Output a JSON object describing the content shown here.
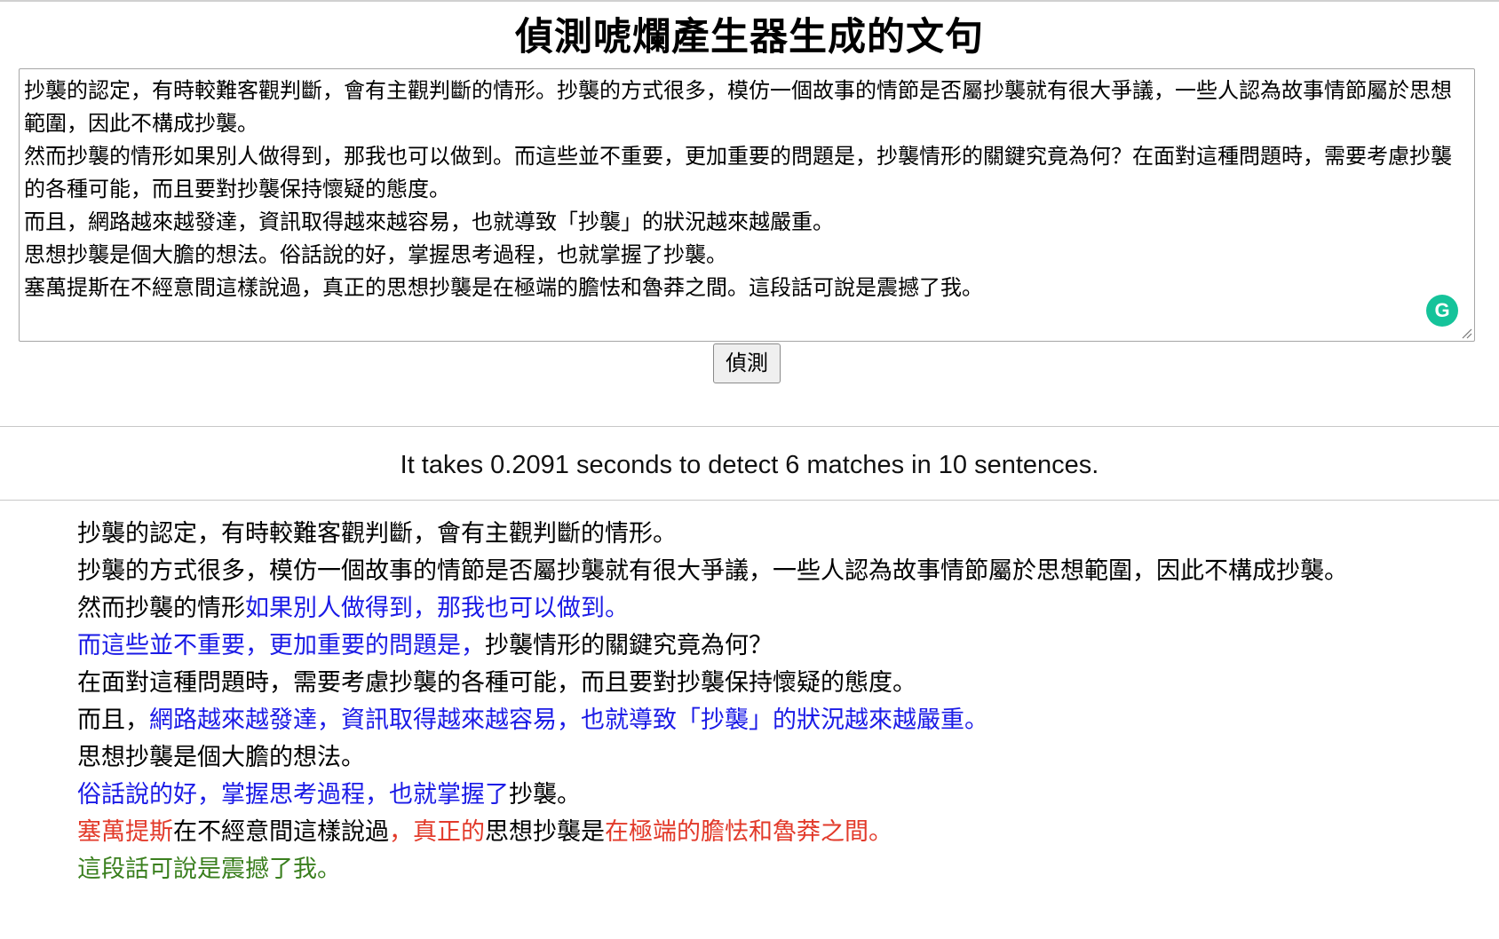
{
  "title": "偵測唬爛產生器生成的文句",
  "input": {
    "value": "抄襲的認定，有時較難客觀判斷，會有主觀判斷的情形。抄襲的方式很多，模仿一個故事的情節是否屬抄襲就有很大爭議，一些人認為故事情節屬於思想範圍，因此不構成抄襲。\n然而抄襲的情形如果別人做得到，那我也可以做到。而這些並不重要，更加重要的問題是，抄襲情形的關鍵究竟為何？在面對這種問題時，需要考慮抄襲的各種可能，而且要對抄襲保持懷疑的態度。\n而且，網路越來越發達，資訊取得越來越容易，也就導致「抄襲」的狀況越來越嚴重。\n思想抄襲是個大膽的想法。俗話說的好，掌握思考過程，也就掌握了抄襲。\n塞萬提斯在不經意間這樣說過，真正的思想抄襲是在極端的膽怯和魯莽之間。這段話可說是震撼了我。"
  },
  "grammarly_badge": "G",
  "detect_button": "偵測",
  "stats": "It takes 0.2091 seconds to detect 6 matches in 10 sentences.",
  "colors": {
    "plain": "#000000",
    "blue": "#1a1ae6",
    "red": "#e23a2a",
    "green": "#3a7f1e"
  },
  "results": [
    [
      {
        "text": "抄襲的認定，有時較難客觀判斷，會有主觀判斷的情形。",
        "color": "plain"
      }
    ],
    [
      {
        "text": "抄襲的方式很多，模仿一個故事的情節是否屬抄襲就有很大爭議，一些人認為故事情節屬於思想範圍，因此不構成抄襲。",
        "color": "plain"
      }
    ],
    [
      {
        "text": "然而抄襲的情形",
        "color": "plain"
      },
      {
        "text": "如果別人做得到，那我也可以做到。",
        "color": "blue"
      }
    ],
    [
      {
        "text": "而這些並不重要，更加重要的問題是，",
        "color": "blue"
      },
      {
        "text": "抄襲情形的關鍵究竟為何？",
        "color": "plain"
      }
    ],
    [
      {
        "text": "在面對這種問題時，需要考慮抄襲的各種可能，而且要對抄襲保持懷疑的態度。",
        "color": "plain"
      }
    ],
    [
      {
        "text": "而且，",
        "color": "plain"
      },
      {
        "text": "網路越來越發達，資訊取得越來越容易，也就導致「抄襲」的狀況越來越嚴重。",
        "color": "blue"
      }
    ],
    [
      {
        "text": "思想抄襲是個大膽的想法。",
        "color": "plain"
      }
    ],
    [
      {
        "text": "俗話說的好，掌握思考過程，也就掌握了",
        "color": "blue"
      },
      {
        "text": "抄襲。",
        "color": "plain"
      }
    ],
    [
      {
        "text": "塞萬提斯",
        "color": "red"
      },
      {
        "text": "在不經意間這樣說過",
        "color": "plain"
      },
      {
        "text": "，真正的",
        "color": "red"
      },
      {
        "text": "思想抄襲是",
        "color": "plain"
      },
      {
        "text": "在極端的膽怯和魯莽之間。",
        "color": "red"
      }
    ],
    [
      {
        "text": "這段話可說是震撼了我。",
        "color": "green"
      }
    ]
  ]
}
